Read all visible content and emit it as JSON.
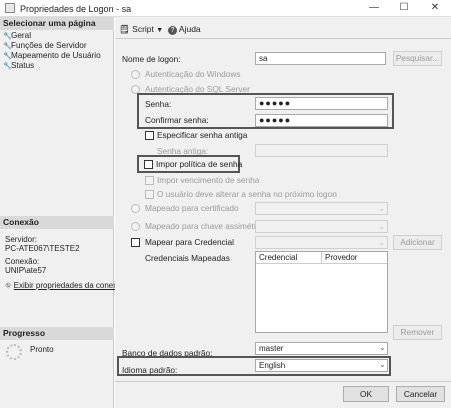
{
  "window": {
    "title": "Propriedades de Logon - sa",
    "minimize": "—",
    "maximize": "☐",
    "close": "✕"
  },
  "left": {
    "select_page_header": "Selecionar uma página",
    "pages": [
      {
        "label": "Geral"
      },
      {
        "label": "Funções de Servidor"
      },
      {
        "label": "Mapeamento de Usuário"
      },
      {
        "label": "Status"
      }
    ],
    "connection_header": "Conexão",
    "server_label": "Servidor:",
    "server_value": "PC-ATE067\\TESTE2",
    "connection_label": "Conexão:",
    "connection_value": "UNIP\\ate57",
    "view_props_link": "Exibir propriedades da conexã",
    "progress_header": "Progresso",
    "progress_status": "Pronto"
  },
  "toolbar": {
    "script_label": "Script",
    "help_label": "Ajuda"
  },
  "form": {
    "login_name_label": "Nome de logon:",
    "login_name_value": "sa",
    "search_button": "Pesquisar...",
    "windows_auth": "Autenticação do Windows",
    "sql_auth": "Autenticação do SQL Server",
    "password_label": "Senha:",
    "password_value": "●●●●●",
    "confirm_label": "Confirmar senha:",
    "confirm_value": "●●●●●",
    "old_password_check": "Especificar senha antiga",
    "old_password_label": "Senha antiga:",
    "enforce_policy": "Impor política de senha",
    "enforce_expiration": "Impor vencimento de senha",
    "must_change": "O usuário deve alterar a senha no próximo logon",
    "map_cert": "Mapeado para certificado",
    "map_asym": "Mapeado para chave assimétrica",
    "map_cred": "Mapear para Credencial",
    "add_button": "Adicionar",
    "mapped_creds_label": "Credenciais Mapeadas",
    "grid_col_credential": "Credencial",
    "grid_col_provider": "Provedor",
    "remove_button": "Remover",
    "default_db_label": "Banco de dados padrão:",
    "default_db_value": "master",
    "default_lang_label": "Idioma padrão:",
    "default_lang_value": "English"
  },
  "footer": {
    "ok_button": "OK",
    "cancel_button": "Cancelar"
  }
}
